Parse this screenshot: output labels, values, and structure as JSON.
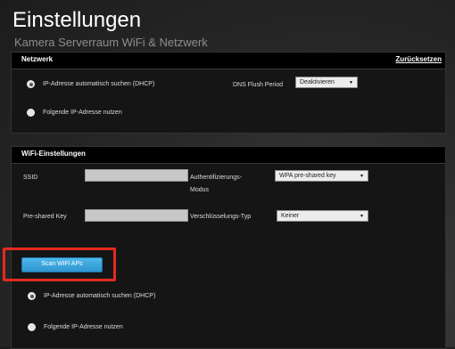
{
  "header": {
    "title": "Einstellungen",
    "subtitle": "Kamera Serverraum WiFi & Netzwerk"
  },
  "network": {
    "heading": "Netzwerk",
    "reset_label": "Zurücksetzen",
    "dhcp_label": "IP-Adresse automatisch suchen (DHCP)",
    "static_label": "Folgende IP-Adresse nutzen",
    "dns_label": "DNS Flush Period",
    "dns_value": "Deaktivieren"
  },
  "wifi": {
    "heading": "WiFi-Einstellungen",
    "ssid_label": "SSID",
    "ssid_value": "",
    "psk_label": "Pre-shared Key",
    "psk_value": "",
    "auth_label_line1": "Authentifizierungs-",
    "auth_label_line2": "Modus",
    "auth_value": "WPA pre-shared key",
    "enc_label": "Verschlüsselungs-Typ",
    "enc_value": "Keiner",
    "scan_button": "Scan WiFi APs",
    "dhcp_label": "IP-Adresse automatisch suchen (DHCP)",
    "static_label": "Folgende IP-Adresse nutzen"
  },
  "colors": {
    "highlight": "#e52b20",
    "button": "#3aa6df"
  },
  "icons": {
    "dropdown": "chevron-down-icon"
  }
}
